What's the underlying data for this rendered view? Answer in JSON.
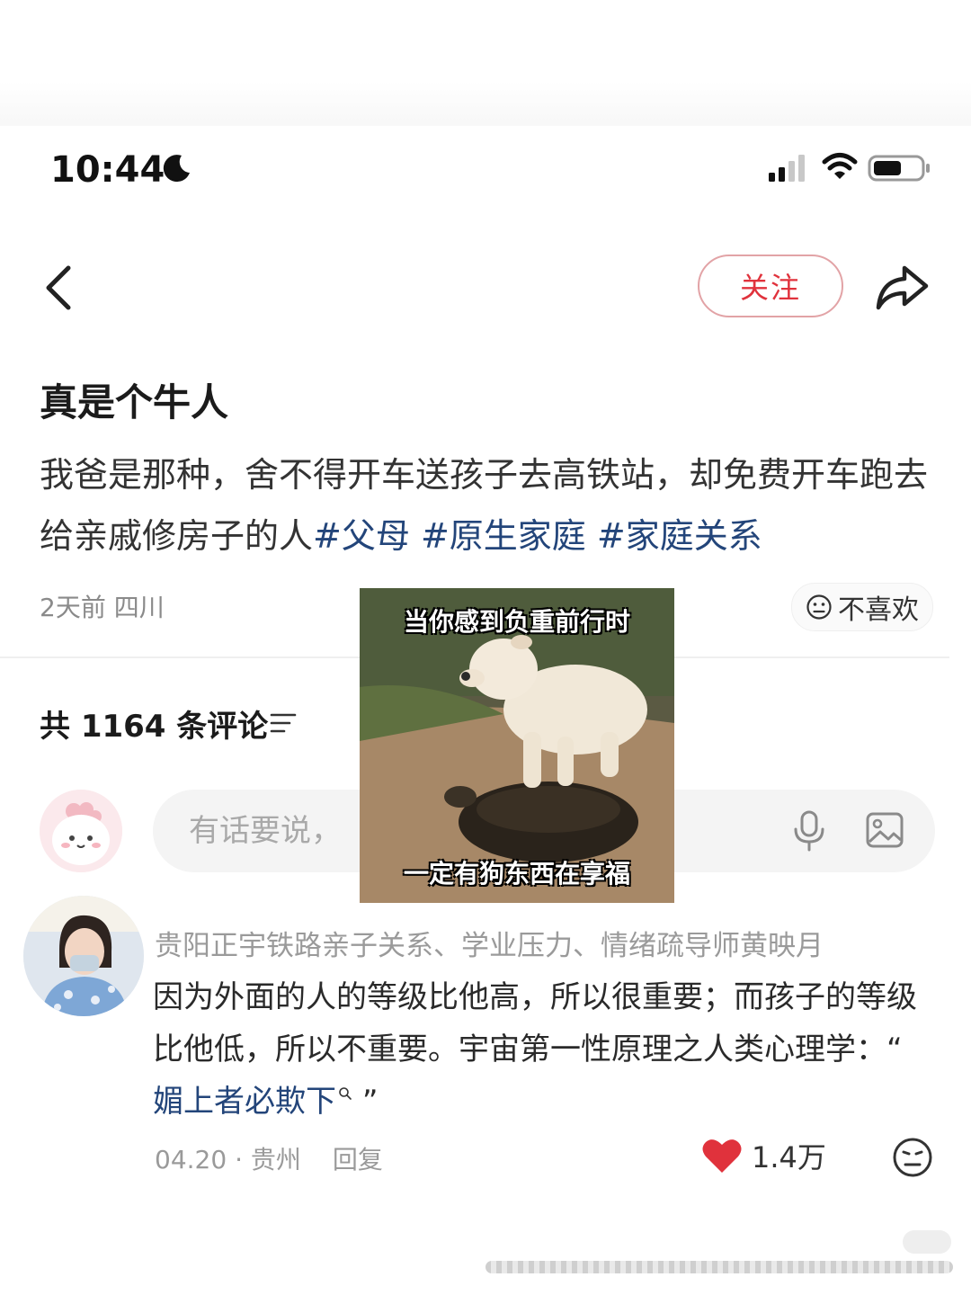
{
  "status_bar": {
    "time": "10:44",
    "moon_icon": "moon-icon",
    "signal_icon": "cellular-signal-icon",
    "wifi_icon": "wifi-icon",
    "battery_icon": "battery-icon"
  },
  "nav": {
    "back_icon": "chevron-left-icon",
    "follow_label": "关注",
    "share_icon": "share-arrow-icon",
    "accent_color": "#e0323c"
  },
  "post": {
    "title": "真是个牛人",
    "body": "我爸是那种，舍不得开车送孩子去高铁站，却免费开车跑去给亲戚修房子的人",
    "hashtags": [
      "#父母",
      "#原生家庭",
      "#家庭关系"
    ],
    "time": "2天前",
    "location": "四川",
    "dislike_label": "不喜欢",
    "hashtag_color": "#23457a"
  },
  "meme": {
    "top_caption": "当你感到负重前行时",
    "bottom_caption": "一定有狗东西在享福"
  },
  "comments_section": {
    "count_label": "共 1164 条评论",
    "sort_icon": "sort-icon",
    "input_placeholder": "有话要说，",
    "mic_icon": "microphone-icon",
    "image_icon": "image-icon"
  },
  "comment": {
    "username": "贵阳正宇铁路亲子关系、学业压力、情绪疏导师黄映月",
    "text_before_link": "因为外面的人的等级比他高，所以很重要；而孩子的等级比他低，所以不重要。宇宙第一性原理之人类心理学：“",
    "link_text": "媚上者必欺下",
    "text_after_link": "”",
    "date": "04.20",
    "separator": "·",
    "location": "贵州",
    "reply_label": "回复",
    "likes": "1.4万",
    "like_color": "#e0323c"
  }
}
